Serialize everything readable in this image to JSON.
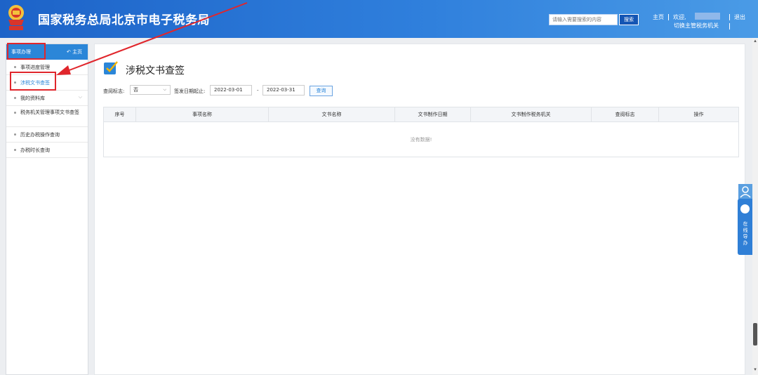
{
  "header": {
    "title": "国家税务总局北京市电子税务局",
    "search_placeholder": "请输入需要搜索的内容",
    "search_button": "搜索",
    "home_link": "主页",
    "welcome": "欢迎,",
    "logout": "退出",
    "switch_org": "切换主管税务机关",
    "colors": {
      "bar_start": "#1d63c8",
      "bar_end": "#4a9be6"
    }
  },
  "sidebar": {
    "title": "事项办理",
    "home": "主页",
    "items": [
      {
        "label": "事项进度管理"
      },
      {
        "label": "涉税文书查签",
        "active": true
      },
      {
        "label": "我的资料库",
        "expandable": true
      },
      {
        "label": "税务机关管理事项文书查签"
      },
      {
        "label": "历史办税操作查询"
      },
      {
        "label": "办税时长查询"
      }
    ]
  },
  "main": {
    "page_title": "涉税文书查签",
    "filters": {
      "query_flag_label": "查阅标志:",
      "query_flag_value": "否",
      "date_label": "签发日期起止:",
      "date_start": "2022-03-01",
      "date_sep": "-",
      "date_end": "2022-03-31",
      "query_button": "查询"
    },
    "table": {
      "columns": [
        "序号",
        "事项名称",
        "文书名称",
        "文书制作日期",
        "文书制作税务机关",
        "查阅标志",
        "操作"
      ],
      "empty_text": "没有数据!"
    }
  },
  "float_widget": {
    "help_text": "在线导办"
  },
  "annotation": {
    "color": "#e0262c"
  }
}
